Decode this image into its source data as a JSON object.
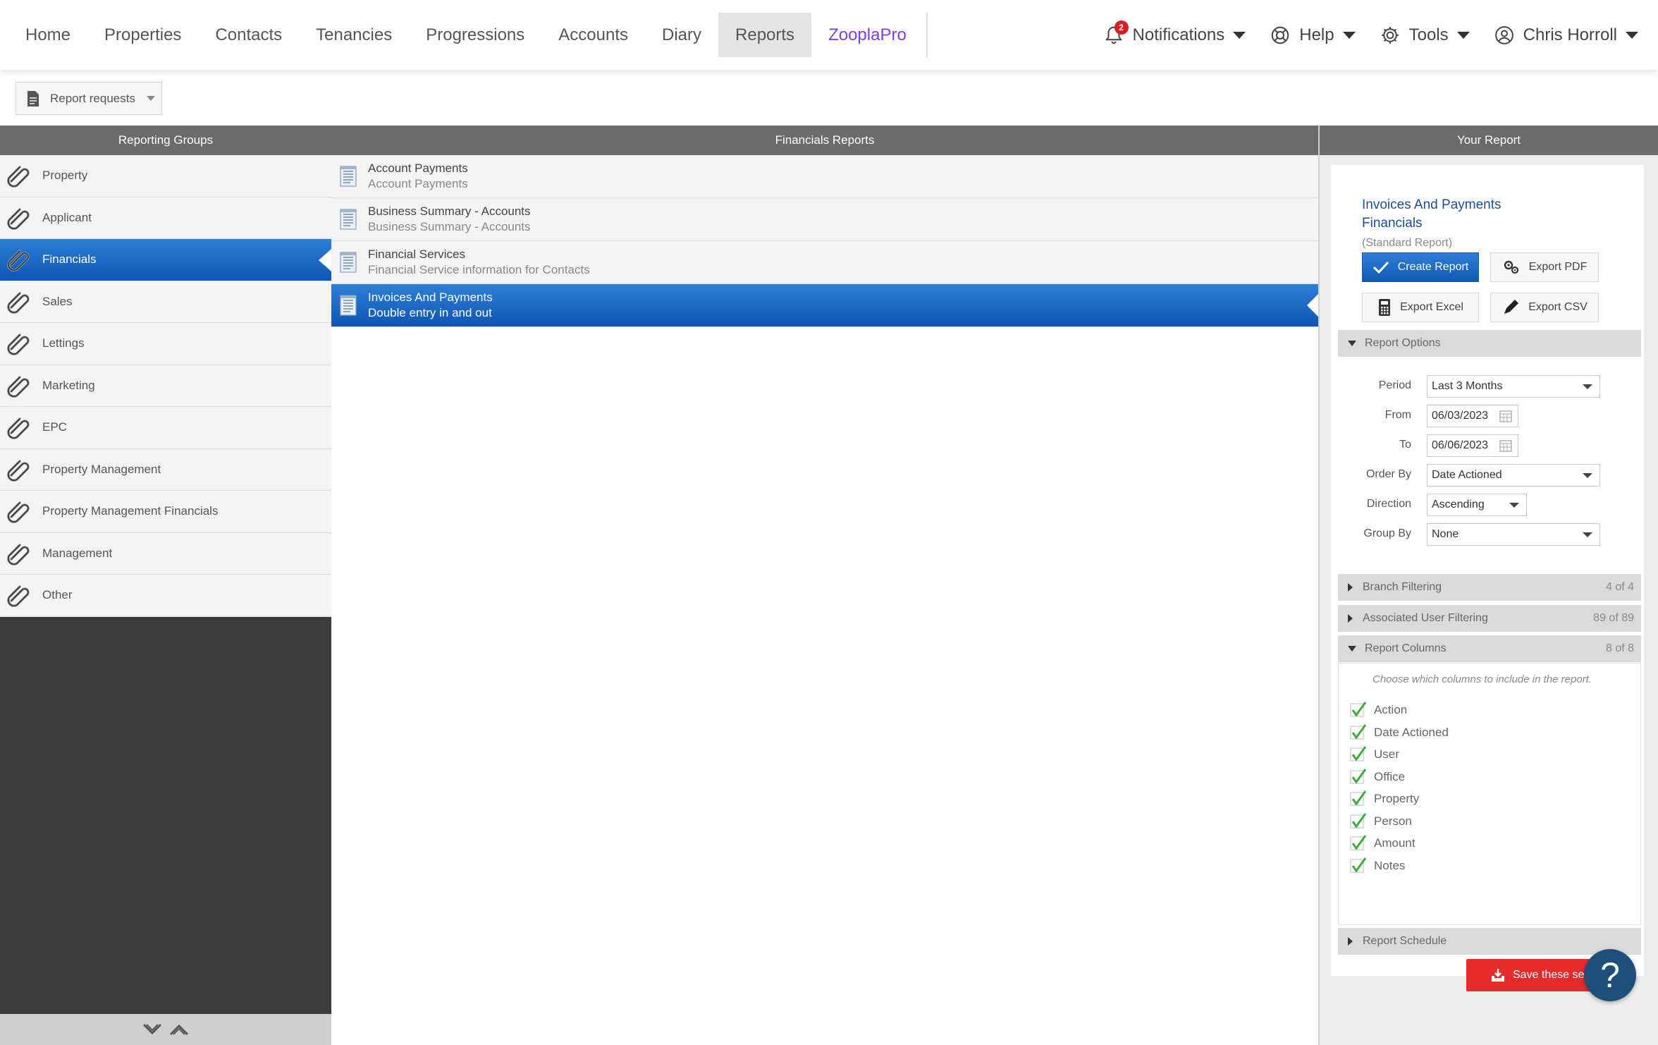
{
  "nav": {
    "items": [
      "Home",
      "Properties",
      "Contacts",
      "Tenancies",
      "Progressions",
      "Accounts",
      "Diary",
      "Reports",
      "ZooplaPro"
    ],
    "active": "Reports",
    "notifications_label": "Notifications",
    "notifications_count": "2",
    "help_label": "Help",
    "tools_label": "Tools",
    "user_label": "Chris Horroll"
  },
  "report_requests_label": "Report requests",
  "headers": {
    "groups": "Reporting Groups",
    "reports": "Financials Reports",
    "your_report": "Your Report"
  },
  "groups": [
    "Property",
    "Applicant",
    "Financials",
    "Sales",
    "Lettings",
    "Marketing",
    "EPC",
    "Property Management",
    "Property Management Financials",
    "Management",
    "Other"
  ],
  "active_group": "Financials",
  "reports": [
    {
      "title": "Account Payments",
      "desc": "Account Payments"
    },
    {
      "title": "Business Summary - Accounts",
      "desc": "Business Summary - Accounts"
    },
    {
      "title": "Financial Services",
      "desc": "Financial Service information for Contacts"
    },
    {
      "title": "Invoices And Payments",
      "desc": "Double entry in and out"
    }
  ],
  "active_report": "Invoices And Payments",
  "your_report": {
    "title_line1": "Invoices And Payments",
    "title_line2": "Financials",
    "subtitle": "(Standard Report)",
    "create_label": "Create Report",
    "export_pdf_label": "Export PDF",
    "export_excel_label": "Export Excel",
    "export_csv_label": "Export CSV"
  },
  "report_options": {
    "heading": "Report Options",
    "period_label": "Period",
    "period_value": "Last 3 Months",
    "from_label": "From",
    "from_value": "06/03/2023",
    "to_label": "To",
    "to_value": "06/06/2023",
    "order_by_label": "Order By",
    "order_by_value": "Date Actioned",
    "direction_label": "Direction",
    "direction_value": "Ascending",
    "group_by_label": "Group By",
    "group_by_value": "None"
  },
  "branch_filtering": {
    "label": "Branch Filtering",
    "count": "4 of 4"
  },
  "user_filtering": {
    "label": "Associated User Filtering",
    "count": "89 of 89"
  },
  "report_columns": {
    "label": "Report Columns",
    "count": "8 of 8",
    "hint": "Choose which columns to include in the report.",
    "columns": [
      "Action",
      "Date Actioned",
      "User",
      "Office",
      "Property",
      "Person",
      "Amount",
      "Notes"
    ]
  },
  "report_schedule_label": "Report Schedule",
  "save_label": "Save these settings",
  "help_fab_label": "?",
  "colors": {
    "accent_blue": "#1258b6",
    "zoopla_purple": "#7b3fe4",
    "save_red": "#e52b2b",
    "check_green": "#3cae3c"
  }
}
